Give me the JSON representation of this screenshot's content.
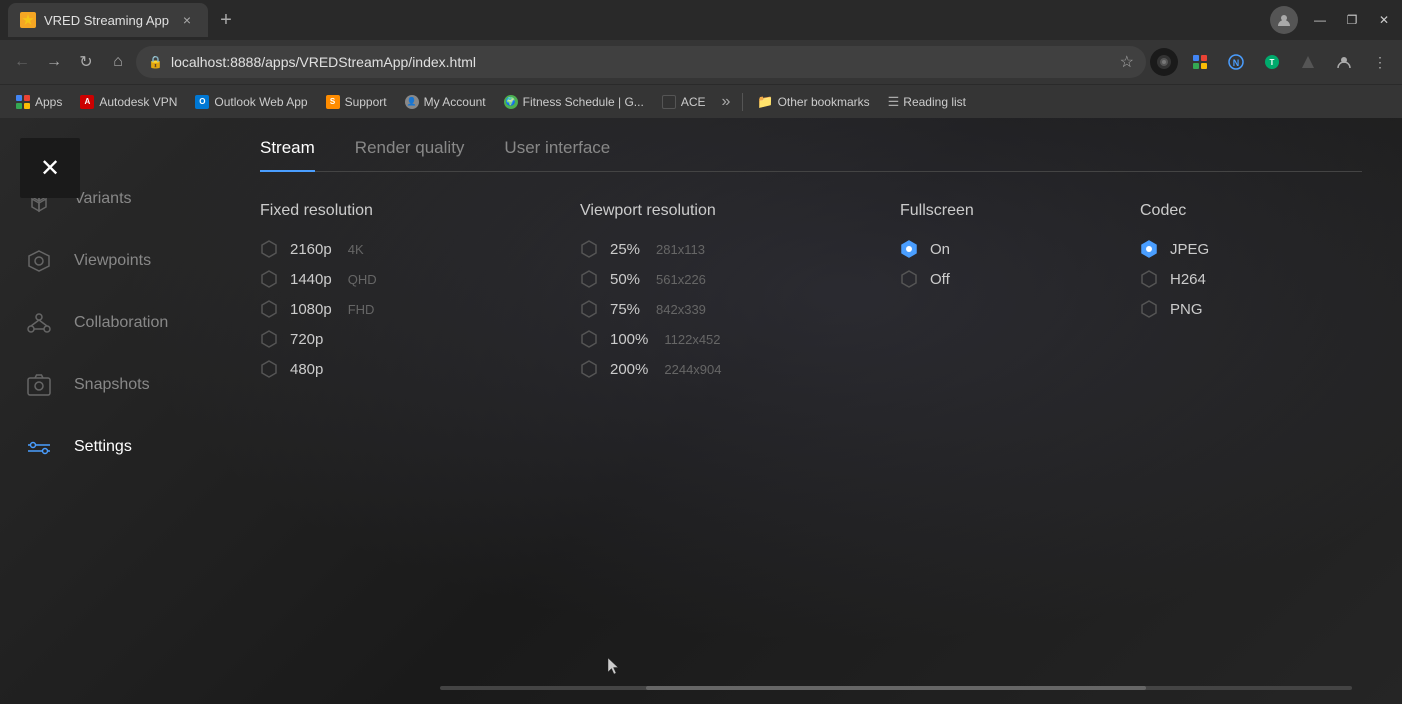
{
  "browser": {
    "tab_title": "VRED Streaming App",
    "tab_close": "×",
    "new_tab": "+",
    "url": "localhost:8888/apps/VREDStreamApp/index.html",
    "win_minimize": "—",
    "win_maximize": "❐",
    "win_close": "✕"
  },
  "bookmarks": [
    {
      "id": "apps",
      "label": "Apps",
      "type": "apps"
    },
    {
      "id": "autodesk",
      "label": "Autodesk VPN",
      "type": "autodesk"
    },
    {
      "id": "outlook",
      "label": "Outlook Web App",
      "type": "outlook"
    },
    {
      "id": "support",
      "label": "Support",
      "type": "support"
    },
    {
      "id": "myaccount",
      "label": "My Account",
      "type": "account"
    },
    {
      "id": "fitness",
      "label": "Fitness Schedule | G...",
      "type": "fitness"
    },
    {
      "id": "ace",
      "label": "ACE",
      "type": "ace"
    }
  ],
  "sidebar": {
    "items": [
      {
        "id": "variants",
        "label": "Variants",
        "active": false
      },
      {
        "id": "viewpoints",
        "label": "Viewpoints",
        "active": false
      },
      {
        "id": "collaboration",
        "label": "Collaboration",
        "active": false
      },
      {
        "id": "snapshots",
        "label": "Snapshots",
        "active": false
      },
      {
        "id": "settings",
        "label": "Settings",
        "active": true
      }
    ]
  },
  "tabs": [
    {
      "id": "stream",
      "label": "Stream",
      "active": true
    },
    {
      "id": "render_quality",
      "label": "Render quality",
      "active": false
    },
    {
      "id": "user_interface",
      "label": "User interface",
      "active": false
    }
  ],
  "stream": {
    "fixed_resolution": {
      "title": "Fixed resolution",
      "options": [
        {
          "id": "2160p",
          "label": "2160p",
          "sub": "4K",
          "checked": false
        },
        {
          "id": "1440p",
          "label": "1440p",
          "sub": "QHD",
          "checked": false
        },
        {
          "id": "1080p",
          "label": "1080p",
          "sub": "FHD",
          "checked": false
        },
        {
          "id": "720p",
          "label": "720p",
          "sub": "",
          "checked": false
        },
        {
          "id": "480p",
          "label": "480p",
          "sub": "",
          "checked": false
        }
      ]
    },
    "viewport_resolution": {
      "title": "Viewport resolution",
      "options": [
        {
          "id": "25",
          "label": "25%",
          "sub": "281x113",
          "checked": false
        },
        {
          "id": "50",
          "label": "50%",
          "sub": "561x226",
          "checked": false
        },
        {
          "id": "75",
          "label": "75%",
          "sub": "842x339",
          "checked": false
        },
        {
          "id": "100",
          "label": "100%",
          "sub": "1122x452",
          "checked": false
        },
        {
          "id": "200",
          "label": "200%",
          "sub": "2244x904",
          "checked": false
        }
      ]
    },
    "fullscreen": {
      "title": "Fullscreen",
      "options": [
        {
          "id": "on",
          "label": "On",
          "checked": true
        },
        {
          "id": "off",
          "label": "Off",
          "checked": false
        }
      ]
    },
    "codec": {
      "title": "Codec",
      "options": [
        {
          "id": "jpeg",
          "label": "JPEG",
          "checked": true
        },
        {
          "id": "h264",
          "label": "H264",
          "checked": false
        },
        {
          "id": "png",
          "label": "PNG",
          "checked": false
        }
      ]
    }
  },
  "other_bookmarks": "Other bookmarks",
  "reading_list": "Reading list"
}
